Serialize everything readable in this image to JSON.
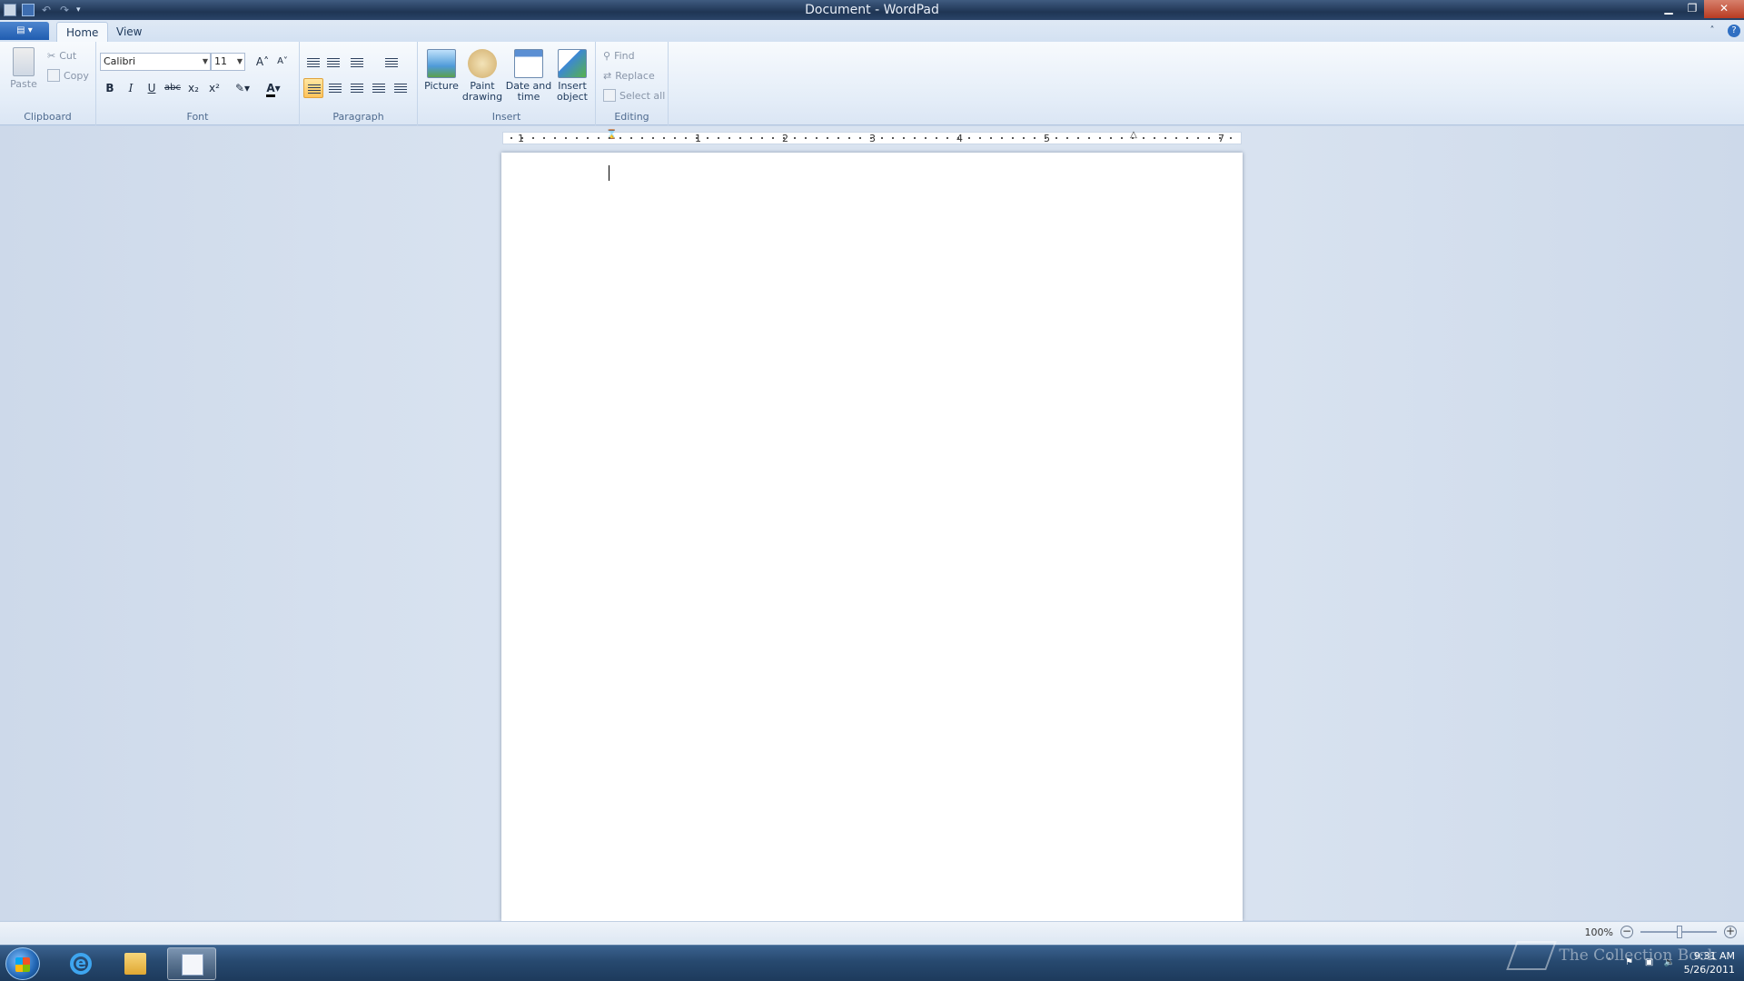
{
  "window": {
    "title": "Document - WordPad"
  },
  "tabs": [
    {
      "label": "Home",
      "active": true
    },
    {
      "label": "View",
      "active": false
    }
  ],
  "clipboard": {
    "paste": "Paste",
    "cut": "Cut",
    "copy": "Copy",
    "label": "Clipboard"
  },
  "font": {
    "family": "Calibri",
    "size": "11",
    "label": "Font",
    "bold": "B",
    "italic": "I",
    "underline": "U",
    "strike": "abc",
    "subscript": "x₂",
    "superscript": "x²",
    "color_glyph": "A"
  },
  "paragraph": {
    "label": "Paragraph",
    "active_alignment": "left"
  },
  "insert": {
    "picture": "Picture",
    "paint_drawing": "Paint drawing",
    "date_time": "Date and time",
    "insert_object": "Insert object",
    "label": "Insert"
  },
  "editing": {
    "find": "Find",
    "replace": "Replace",
    "select_all": "Select all",
    "label": "Editing"
  },
  "ruler": {
    "numbers": [
      "1",
      "1",
      "2",
      "3",
      "4",
      "5",
      "7"
    ]
  },
  "statusbar": {
    "zoom": "100%"
  },
  "taskbar": {
    "time": "9:31 AM",
    "date": "5/26/2011"
  },
  "watermark": "The Collection Book",
  "colors": {
    "accent": "#2a5591",
    "selected": "#ffc35a",
    "taskbar": "#27496f"
  }
}
